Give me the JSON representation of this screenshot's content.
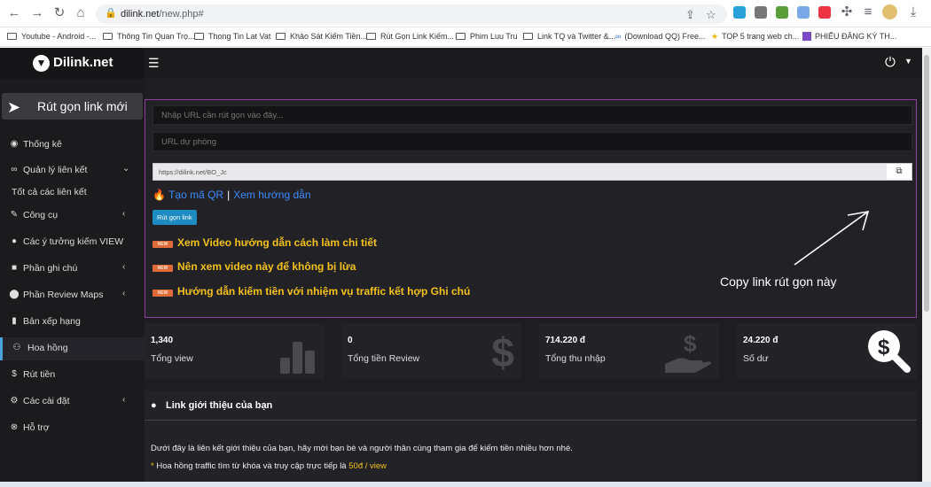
{
  "browser": {
    "url_host": "dilink.net",
    "url_path": "/new.php#",
    "bookmarks": [
      "Youtube - Android -...",
      "Thông Tin Quan Trọ...",
      "Thong Tin Lat Vat",
      "Khảo Sát Kiếm Tiền...",
      "Rút Gọn Link Kiếm...",
      "Phim Luu Tru",
      "Link TQ và Twitter &...",
      "(Download QQ) Free...",
      "TOP 5 trang web ch...",
      "PHIẾU ĐĂNG KÝ TH..."
    ]
  },
  "brand": {
    "name": "Dilink.net"
  },
  "sidebar": {
    "new_link": "Rút gọn link mới",
    "items": [
      {
        "icon": "dashboard-icon",
        "label": "Thống kê"
      },
      {
        "icon": "link-icon",
        "label": "Quản lý liên kết"
      },
      {
        "icon": "",
        "label": "Tốt cả các liên kết"
      },
      {
        "icon": "wrench-icon",
        "label": "Công cụ"
      },
      {
        "icon": "bulb-icon",
        "label": "Các ý tưởng kiếm VIEW"
      },
      {
        "icon": "clipboard-icon",
        "label": "Phần ghi chú"
      },
      {
        "icon": "map-pin-icon",
        "label": "Phần Review Maps"
      },
      {
        "icon": "ranking-icon",
        "label": "Bản xếp hạng"
      },
      {
        "icon": "users-icon",
        "label": "Hoa hồng"
      },
      {
        "icon": "dollar-icon",
        "label": "Rút tiền"
      },
      {
        "icon": "cogs-icon",
        "label": "Các cài đặt"
      },
      {
        "icon": "help-icon",
        "label": "Hỗ trợ"
      }
    ]
  },
  "form": {
    "url_placeholder": "Nhập URL cần rút gọn vào đây...",
    "backup_placeholder": "URL dự phòng",
    "short_link": "https://dilink.net/BO_Jc",
    "qr_label": "Tạo mã QR",
    "guide_label": "Xem hướng dẫn",
    "submit": "Rút gọn link",
    "new_badge": "NEW",
    "promos": [
      "Xem Video hướng dẫn cách làm chi tiết",
      "Nên xem video này để không bị lừa",
      "Hướng dẫn kiếm tiền với nhiệm vụ traffic kết hợp Ghi chú"
    ],
    "annotation": "Copy link rút gọn này"
  },
  "stats": [
    {
      "value": "1,340",
      "label": "Tổng view",
      "icon": "bar-chart-icon"
    },
    {
      "value": "0",
      "label": "Tổng tiền Review",
      "icon": "dollar-sign-icon"
    },
    {
      "value": "714.220 đ",
      "label": "Tổng thu nhập",
      "icon": "hand-dollar-icon"
    },
    {
      "value": "24.220 đ",
      "label": "Số dư",
      "icon": "search-dollar-icon"
    }
  ],
  "referral": {
    "title": "Link giới thiệu của bạn",
    "desc": "Dưới đây là liên kết giới thiệu của bạn, hãy mời bạn bè và người thân cùng tham gia để kiếm tiền nhiều hơn nhé.",
    "note": "Hoa hồng traffic tìm từ khóa và truy cập trực tiếp là",
    "rate": "50đ / view"
  }
}
